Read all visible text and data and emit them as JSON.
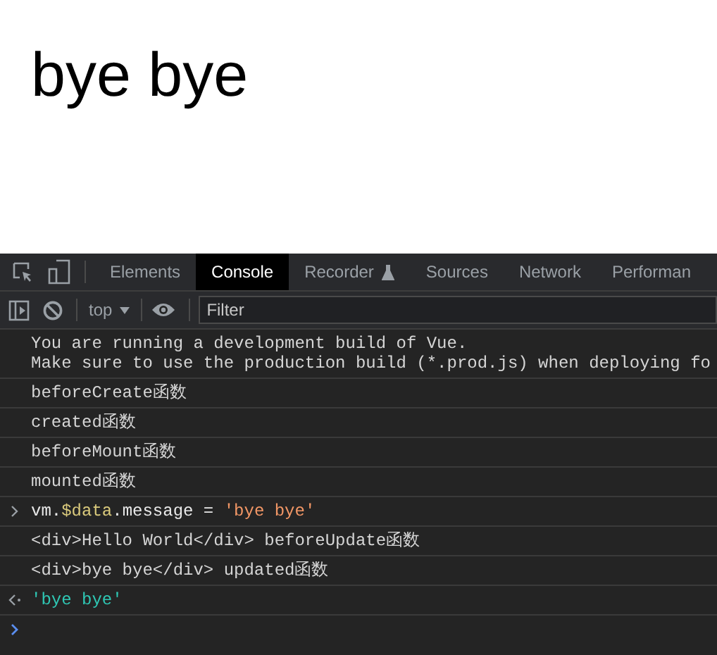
{
  "page": {
    "heading": "bye bye"
  },
  "devtools": {
    "tabs": [
      {
        "label": "Elements",
        "selected": false,
        "experimental": false
      },
      {
        "label": "Console",
        "selected": true,
        "experimental": false
      },
      {
        "label": "Recorder",
        "selected": false,
        "experimental": true
      },
      {
        "label": "Sources",
        "selected": false,
        "experimental": false
      },
      {
        "label": "Network",
        "selected": false,
        "experimental": false
      },
      {
        "label": "Performan",
        "selected": false,
        "experimental": false
      }
    ],
    "toolbar": {
      "context": "top",
      "filter": {
        "placeholder": "Filter"
      }
    },
    "console": [
      {
        "kind": "log",
        "lines": [
          "You are running a development build of Vue.",
          "Make sure to use the production build (*.prod.js) when deploying fo"
        ]
      },
      {
        "kind": "log",
        "lines": [
          "beforeCreate函数"
        ]
      },
      {
        "kind": "log",
        "lines": [
          "created函数"
        ]
      },
      {
        "kind": "log",
        "lines": [
          "beforeMount函数"
        ]
      },
      {
        "kind": "log",
        "lines": [
          "mounted函数"
        ]
      },
      {
        "kind": "input",
        "tokens": [
          {
            "kind": "plain",
            "text": "vm."
          },
          {
            "kind": "variable",
            "text": "$data"
          },
          {
            "kind": "plain",
            "text": ".message = "
          },
          {
            "kind": "string",
            "text": "'bye bye'"
          }
        ]
      },
      {
        "kind": "log",
        "lines": [
          "<div>Hello World</div> beforeUpdate函数"
        ]
      },
      {
        "kind": "log",
        "lines": [
          "<div>bye bye</div> updated函数"
        ]
      },
      {
        "kind": "result",
        "text": "'bye bye'"
      },
      {
        "kind": "prompt"
      }
    ]
  }
}
